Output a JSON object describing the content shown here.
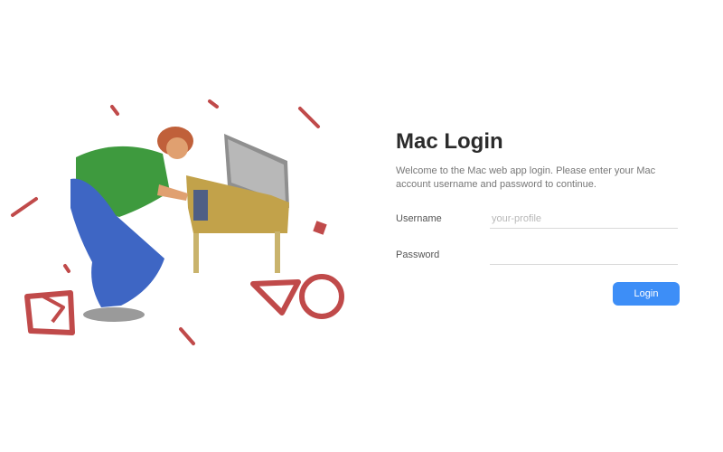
{
  "login": {
    "title": "Mac Login",
    "description": "Welcome to the Mac web app login. Please enter your Mac account username and password to continue.",
    "username_label": "Username",
    "username_placeholder": "your-profile",
    "password_label": "Password",
    "password_placeholder": "",
    "button_label": "Login"
  },
  "illustration": {
    "description_icon": "person-at-computer-illustration"
  },
  "colors": {
    "accent": "#3d8ef7",
    "shirt": "#3e9a3e",
    "pants": "#3e66c4",
    "hair": "#c0603a",
    "desk": "#c2a24a",
    "decor": "#c04a4a",
    "monitor": "#8f8f8f"
  }
}
